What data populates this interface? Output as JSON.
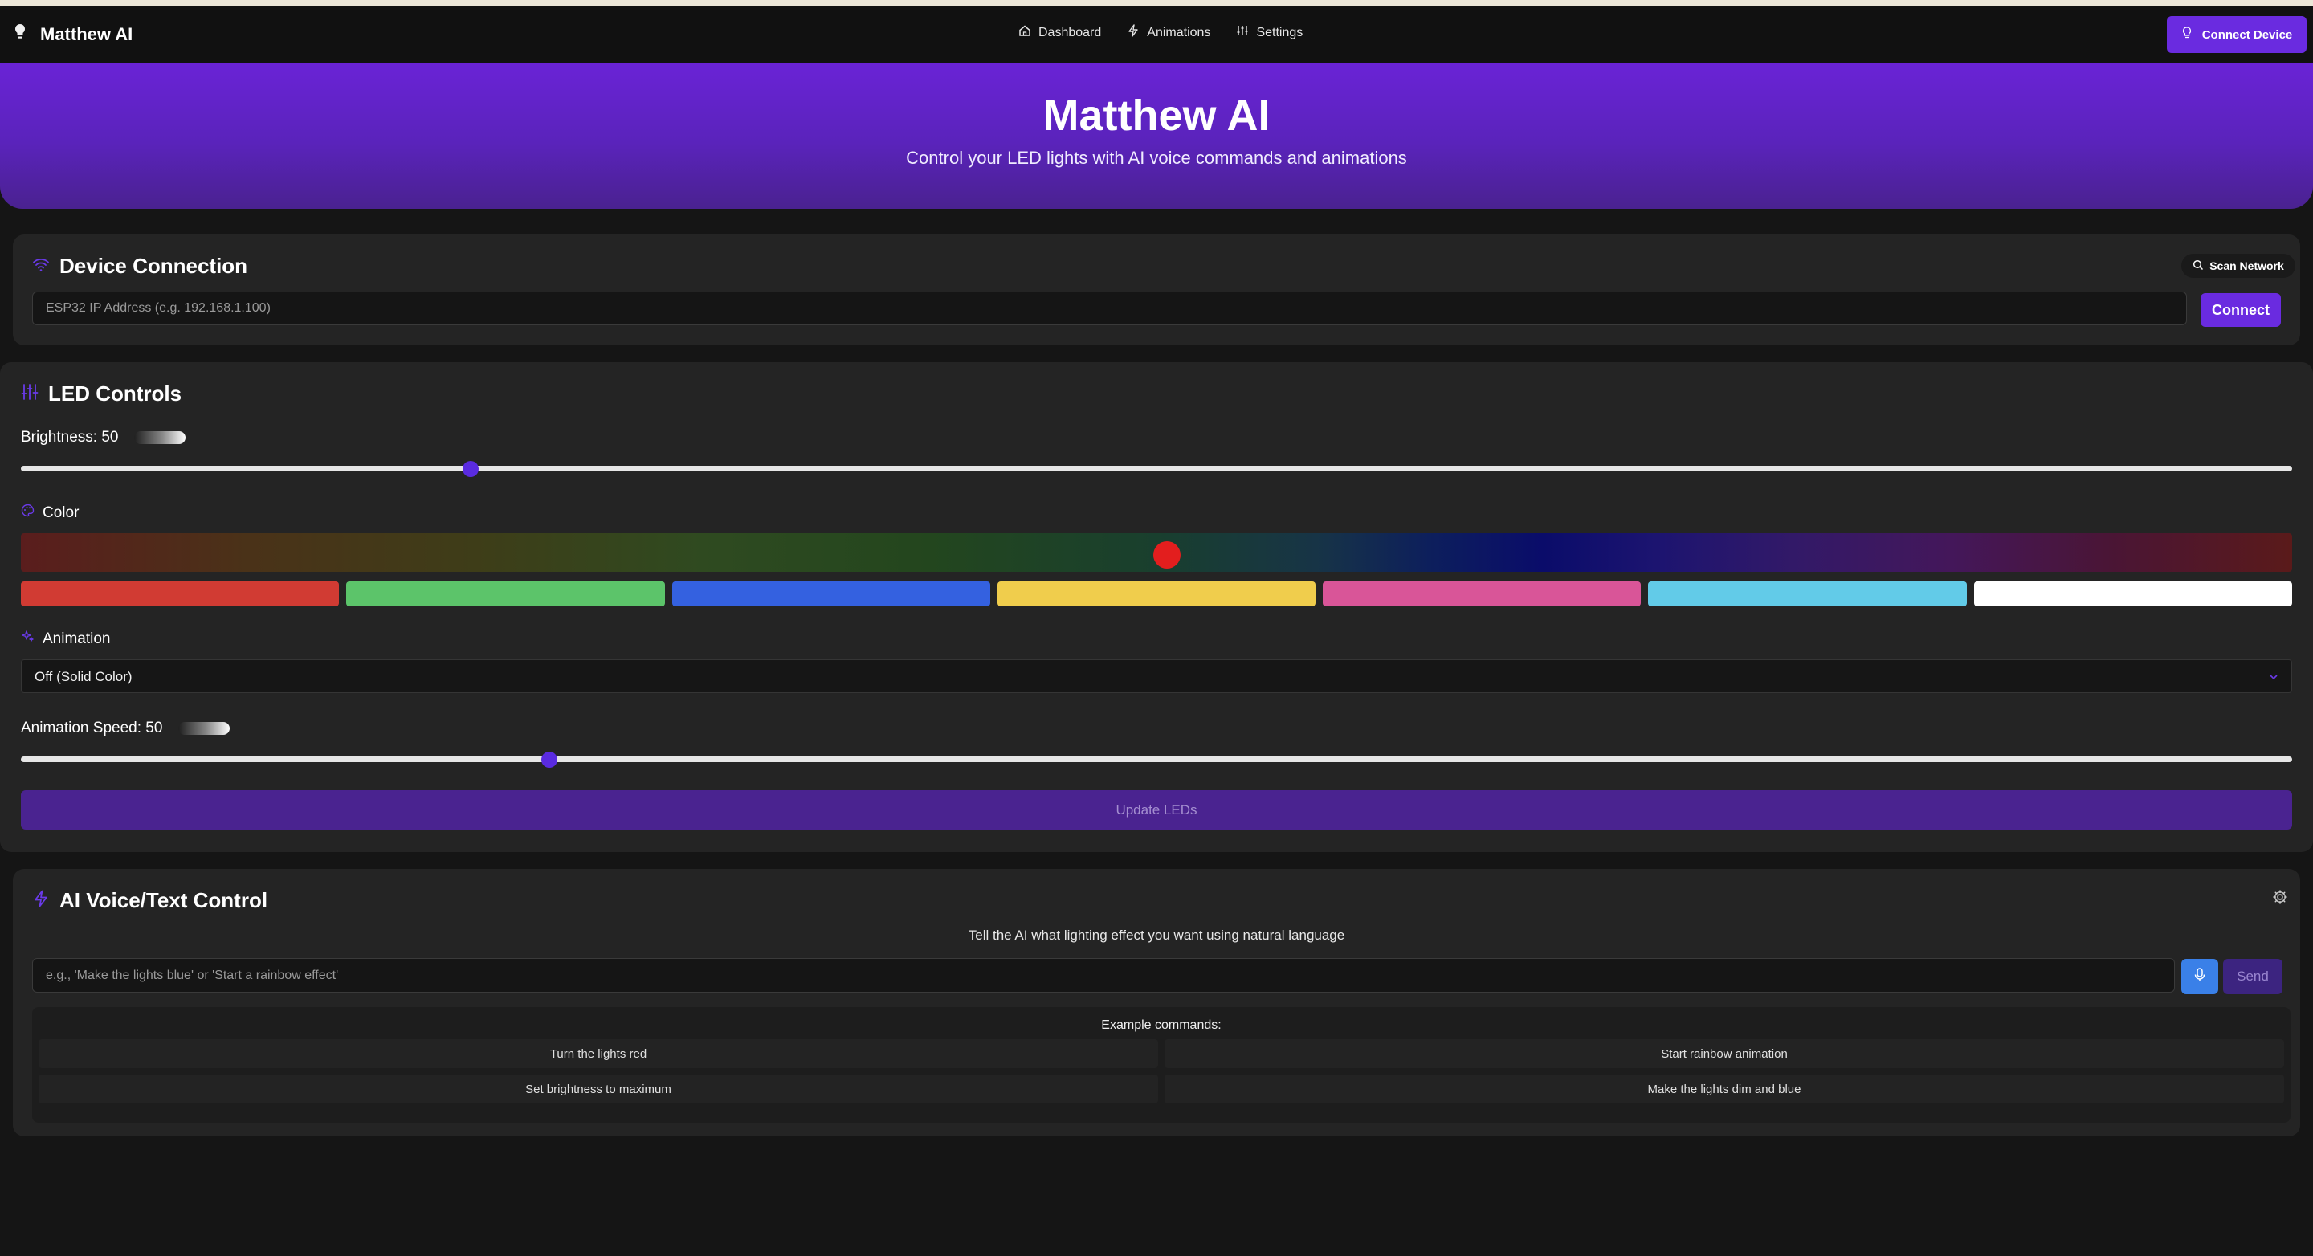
{
  "app": {
    "brand": "Matthew AI"
  },
  "nav": {
    "links": [
      {
        "label": "Dashboard",
        "icon": "home-icon"
      },
      {
        "label": "Animations",
        "icon": "zap-icon"
      },
      {
        "label": "Settings",
        "icon": "sliders-icon"
      }
    ],
    "connect_device_label": "Connect Device"
  },
  "hero": {
    "title": "Matthew AI",
    "subtitle": "Control your LED lights with AI voice commands and animations"
  },
  "device": {
    "title": "Device Connection",
    "scan_label": "Scan Network",
    "ip_placeholder": "ESP32 IP Address (e.g. 192.168.1.100)",
    "connect_label": "Connect"
  },
  "led": {
    "title": "LED Controls",
    "brightness_label": "Brightness: 50",
    "brightness_value": 50,
    "color_label": "Color",
    "selected_color": "#e31e1e",
    "swatches": [
      "#d13b33",
      "#5cc46a",
      "#3461e0",
      "#f0cd4c",
      "#d95598",
      "#62cbe8",
      "#ffffff"
    ],
    "animation_label": "Animation",
    "animation_selected": "Off (Solid Color)",
    "speed_label": "Animation Speed: 50",
    "speed_value": 50,
    "update_label": "Update LEDs"
  },
  "ai": {
    "title": "AI Voice/Text Control",
    "description": "Tell the AI what lighting effect you want using natural language",
    "input_placeholder": "e.g., 'Make the lights blue' or 'Start a rainbow effect'",
    "send_label": "Send",
    "examples_title": "Example commands:",
    "examples": [
      "Turn the lights red",
      "Start rainbow animation",
      "Set brightness to maximum",
      "Make the lights dim and blue"
    ]
  },
  "colors": {
    "accent": "#6a2be0",
    "background": "#151515",
    "card": "#242424"
  }
}
